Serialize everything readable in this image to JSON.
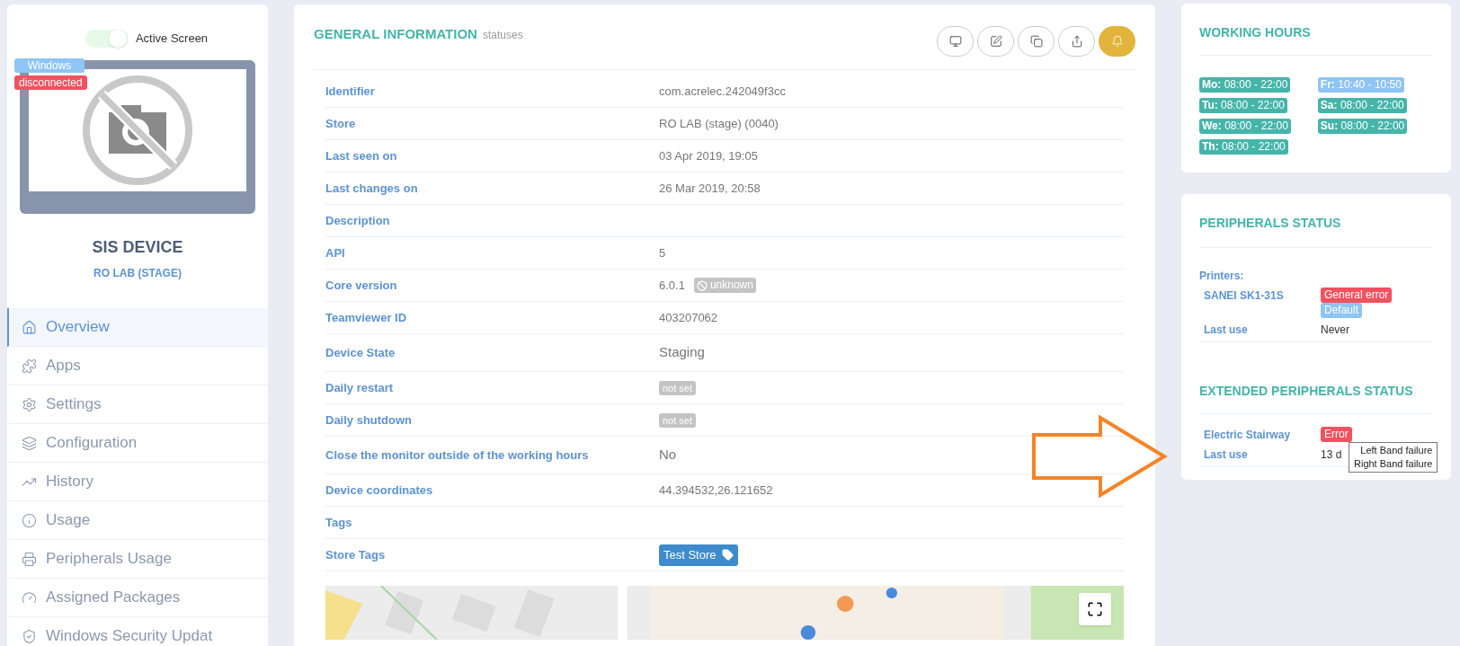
{
  "sidebar": {
    "toggle": {
      "label": "Active Screen",
      "on": true
    },
    "badges": [
      {
        "text": "Windows",
        "color": "#8ec5f5"
      },
      {
        "text": "disconnected",
        "color": "#f0525f"
      }
    ],
    "device_name": "SIS DEVICE",
    "store": "RO LAB (STAGE)",
    "nav": [
      {
        "label": "Overview",
        "selected": true
      },
      {
        "label": "Apps",
        "selected": false
      },
      {
        "label": "Settings",
        "selected": false
      },
      {
        "label": "Configuration",
        "selected": false
      },
      {
        "label": "History",
        "selected": false
      },
      {
        "label": "Usage",
        "selected": false
      },
      {
        "label": "Peripherals Usage",
        "selected": false
      },
      {
        "label": "Assigned Packages",
        "selected": false
      },
      {
        "label": "Windows Security Updat",
        "selected": false
      }
    ]
  },
  "general": {
    "title": "GENERAL INFORMATION",
    "subtitle": "statuses",
    "rows": [
      {
        "label": "Identifier",
        "kind": "text",
        "value": "com.acrelec.242049f3cc"
      },
      {
        "label": "Store",
        "kind": "text",
        "value": "RO LAB (stage) (0040)"
      },
      {
        "label": "Last seen on",
        "kind": "text",
        "value": "03 Apr 2019, 19:05"
      },
      {
        "label": "Last changes on",
        "kind": "text",
        "value": "26 Mar 2019, 20:58"
      },
      {
        "label": "Description",
        "kind": "empty"
      },
      {
        "label": "API",
        "kind": "text",
        "value": "5"
      },
      {
        "label": "Core version",
        "kind": "version",
        "value": "6.0.1",
        "badge": "unknown"
      },
      {
        "label": "Teamviewer ID",
        "kind": "text",
        "value": "403207062"
      },
      {
        "label": "Device State",
        "kind": "large",
        "value": "Staging"
      },
      {
        "label": "Daily restart",
        "kind": "badge",
        "value": "not set"
      },
      {
        "label": "Daily shutdown",
        "kind": "badge",
        "value": "not set"
      },
      {
        "label": "Close the monitor outside of the working hours",
        "kind": "large",
        "value": "No"
      },
      {
        "label": "Device coordinates",
        "kind": "text",
        "value": "44.394532,26.121652"
      },
      {
        "label": "Tags",
        "kind": "empty"
      },
      {
        "label": "Store Tags",
        "kind": "tag",
        "value": "Test Store"
      }
    ]
  },
  "working_hours": {
    "title": "WORKING HOURS",
    "days": [
      {
        "day": "Mo:",
        "hours": "08:00 - 22:00",
        "color": "#45b5aa"
      },
      {
        "day": "Tu:",
        "hours": "08:00 - 22:00",
        "color": "#45b5aa"
      },
      {
        "day": "We:",
        "hours": "08:00 - 22:00",
        "color": "#45b5aa"
      },
      {
        "day": "Th:",
        "hours": "08:00 - 22:00",
        "color": "#45b5aa"
      },
      {
        "day": "Fr:",
        "hours": "10:40 - 10:50",
        "color": "#8ec5f5"
      },
      {
        "day": "Sa:",
        "hours": "08:00 - 22:00",
        "color": "#45b5aa"
      },
      {
        "day": "Su:",
        "hours": "08:00 - 22:00",
        "color": "#45b5aa"
      }
    ]
  },
  "peripherals": {
    "title": "PERIPHERALS STATUS",
    "group": "Printers:",
    "items": [
      {
        "name": "SANEI SK1-31S",
        "statuses": [
          {
            "text": "General error",
            "color": "#f0525f"
          },
          {
            "text": "Default",
            "color": "#8ec5f5"
          }
        ]
      }
    ],
    "last_use_label": "Last use",
    "last_use": "Never"
  },
  "extended": {
    "title": "EXTENDED PERIPHERALS STATUS",
    "items": [
      {
        "name": "Electric Stairway",
        "statuses": [
          {
            "text": "Error",
            "color": "#f0525f"
          }
        ]
      }
    ],
    "last_use_label": "Last use",
    "last_use": "13 d",
    "tooltip": [
      "Left Band failure",
      "Right Band failure"
    ]
  }
}
